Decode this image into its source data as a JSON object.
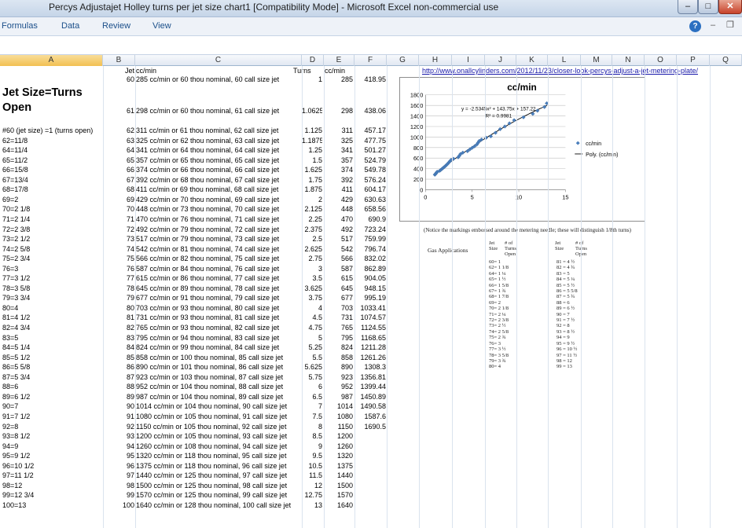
{
  "window": {
    "title": "Percys Adjustajet Holley turns per jet size chart1  [Compatibility Mode] - Microsoft Excel non-commercial use"
  },
  "ribbon": {
    "tabs": [
      "Formulas",
      "Data",
      "Review",
      "View"
    ]
  },
  "columns": [
    "A",
    "B",
    "C",
    "D",
    "E",
    "F",
    "G",
    "H",
    "I",
    "J",
    "K",
    "L",
    "M",
    "N",
    "O",
    "P",
    "Q"
  ],
  "header_row": {
    "b": "Jet",
    "c": "cc/min",
    "d": "Turns",
    "e": "cc/min"
  },
  "big_label": {
    "line1": "Jet Size=Turns",
    "line2": "Open"
  },
  "link": "http://www.onallcylinders.com/2012/11/23/closer-look-percys-adjust-a-jet-metering-plate/",
  "rows": [
    [
      "",
      "60",
      "285 cc/min or 60 thou nominal, 60 call size jet",
      "1",
      "285",
      "418.95"
    ],
    [
      "",
      "61",
      "298 cc/min or 60 thou nominal, 61 call size jet",
      "1.0625",
      "298",
      "438.06"
    ],
    [
      "#60 (jet size) =1 (turns open)",
      "62",
      "311 cc/min or 61 thou nominal, 62 call size jet",
      "1.125",
      "311",
      "457.17"
    ],
    [
      "62=11/8",
      "63",
      "325 cc/min or 62 thou nominal, 63 call size jet",
      "1.1875",
      "325",
      "477.75"
    ],
    [
      "64=11/4",
      "64",
      "341 cc/min or 64 thou nominal, 64 call size jet",
      "1.25",
      "341",
      "501.27"
    ],
    [
      "65=11/2",
      "65",
      "357 cc/min or 65 thou nominal, 65 call size jet",
      "1.5",
      "357",
      "524.79"
    ],
    [
      "66=15/8",
      "66",
      "374 cc/min or 66 thou nominal, 66 call size jet",
      "1.625",
      "374",
      "549.78"
    ],
    [
      "67=13/4",
      "67",
      "392 cc/min or 68 thou nominal, 67 call size jet",
      "1.75",
      "392",
      "576.24"
    ],
    [
      "68=17/8",
      "68",
      "411 cc/min or 69 thou nominal, 68 call size jet",
      "1.875",
      "411",
      "604.17"
    ],
    [
      "69=2",
      "69",
      "429 cc/min or 70 thou nominal, 69 call size jet",
      "2",
      "429",
      "630.63"
    ],
    [
      "70=2 1/8",
      "70",
      "448 cc/min or 73 thou nominal, 70 call size jet",
      "2.125",
      "448",
      "658.56"
    ],
    [
      "71=2 1/4",
      "71",
      "470 cc/min or 76 thou nominal, 71 call size jet",
      "2.25",
      "470",
      "690.9"
    ],
    [
      "72=2 3/8",
      "72",
      "492 cc/min or 79 thou nominal, 72 call size jet",
      "2.375",
      "492",
      "723.24"
    ],
    [
      "73=2 1/2",
      "73",
      "517 cc/min or 79 thou nominal, 73 call size jet",
      "2.5",
      "517",
      "759.99"
    ],
    [
      "74=2 5/8",
      "74",
      "542 cc/min or 81 thou nominal, 74 call size jet",
      "2.625",
      "542",
      "796.74"
    ],
    [
      "75=2 3/4",
      "75",
      "566 cc/min or 82 thou nominal, 75 call size jet",
      "2.75",
      "566",
      "832.02"
    ],
    [
      "76=3",
      "76",
      "587 cc/min or 84 thou nominal, 76 call size jet",
      "3",
      "587",
      "862.89"
    ],
    [
      "77=3 1/2",
      "77",
      "615 cc/min or 86 thou nominal, 77 call size jet",
      "3.5",
      "615",
      "904.05"
    ],
    [
      "78=3 5/8",
      "78",
      "645 cc/min or 89 thou nominal, 78 call size jet",
      "3.625",
      "645",
      "948.15"
    ],
    [
      "79=3 3/4",
      "79",
      "677 cc/min or 91 thou nominal, 79 call size jet",
      "3.75",
      "677",
      "995.19"
    ],
    [
      "80=4",
      "80",
      "703 cc/min or 93 thou nominal, 80 call size jet",
      "4",
      "703",
      "1033.41"
    ],
    [
      "81=4 1/2",
      "81",
      "731 cc/min or 93 thou nominal, 81 call size jet",
      "4.5",
      "731",
      "1074.57"
    ],
    [
      "82=4 3/4",
      "82",
      "765 cc/min or 93 thou nominal, 82 call size jet",
      "4.75",
      "765",
      "1124.55"
    ],
    [
      "83=5",
      "83",
      "795 cc/min or 94 thou nominal, 83 call size jet",
      "5",
      "795",
      "1168.65"
    ],
    [
      "84=5 1/4",
      "84",
      "824 cc/min or 99 thou nominal, 84 call size jet",
      "5.25",
      "824",
      "1211.28"
    ],
    [
      "85=5 1/2",
      "85",
      "858 cc/min or 100 thou nominal, 85 call size jet",
      "5.5",
      "858",
      "1261.26"
    ],
    [
      "86=5 5/8",
      "86",
      "890 cc/min or 101 thou nominal, 86 call size jet",
      "5.625",
      "890",
      "1308.3"
    ],
    [
      "87=5 3/4",
      "87",
      "923 cc/min or 103 thou nominal, 87 call size jet",
      "5.75",
      "923",
      "1356.81"
    ],
    [
      "88=6",
      "88",
      "952 cc/min or 104 thou nominal, 88 call size jet",
      "6",
      "952",
      "1399.44"
    ],
    [
      "89=6 1/2",
      "89",
      "987 cc/min or 104 thou nominal, 89 call size jet",
      "6.5",
      "987",
      "1450.89"
    ],
    [
      "90=7",
      "90",
      "1014 cc/min or 104 thou nominal, 90 call size jet",
      "7",
      "1014",
      "1490.58"
    ],
    [
      "91=7 1/2",
      "91",
      "1080 cc/min or 105 thou nominal, 91 call size jet",
      "7.5",
      "1080",
      "1587.6"
    ],
    [
      "92=8",
      "92",
      "1150 cc/min or 105 thou nominal, 92 call size jet",
      "8",
      "1150",
      "1690.5"
    ],
    [
      "93=8 1/2",
      "93",
      "1200 cc/min or 105 thou nominal, 93 call size jet",
      "8.5",
      "1200",
      ""
    ],
    [
      "94=9",
      "94",
      "1260 cc/min or 108 thou nominal, 94 call size jet",
      "9",
      "1260",
      ""
    ],
    [
      "95=9 1/2",
      "95",
      "1320 cc/min or 118 thou nominal, 95 call size jet",
      "9.5",
      "1320",
      ""
    ],
    [
      "96=10 1/2",
      "96",
      "1375 cc/min or 118 thou nominal, 96 call size jet",
      "10.5",
      "1375",
      ""
    ],
    [
      "97=11 1/2",
      "97",
      "1440 cc/min or 125 thou nominal, 97 call size jet",
      "11.5",
      "1440",
      ""
    ],
    [
      "98=12",
      "98",
      "1500 cc/min or 125 thou nominal, 98 call size jet",
      "12",
      "1500",
      ""
    ],
    [
      "99=12 3/4",
      "99",
      "1570 cc/min or 125 thou nominal, 99 call size jet",
      "12.75",
      "1570",
      ""
    ],
    [
      "100=13",
      "100",
      "1640 cc/min or 128 thou nominal, 100 call size jet",
      "13",
      "1640",
      ""
    ]
  ],
  "chart_data": {
    "type": "scatter",
    "title": "cc/min",
    "xlabel": "",
    "ylabel": "",
    "xlim": [
      0,
      15
    ],
    "ylim": [
      0,
      1800
    ],
    "xticks": [
      0,
      5,
      10,
      15
    ],
    "yticks": [
      0,
      200,
      400,
      600,
      800,
      1000,
      1200,
      1400,
      1600,
      1800
    ],
    "grid": "horizontal",
    "legend": "right",
    "equation": "y = -2.5345x² + 143.75x + 157.22",
    "r_squared": "R² = 0.9981",
    "trend_coeffs": [
      157.22,
      143.75,
      -2.5345
    ],
    "colors": {
      "series": "#4a7ebb",
      "trend": "#000000"
    },
    "series": [
      {
        "name": "cc/min",
        "x": [
          1,
          1.0625,
          1.125,
          1.1875,
          1.25,
          1.5,
          1.625,
          1.75,
          1.875,
          2,
          2.125,
          2.25,
          2.375,
          2.5,
          2.625,
          2.75,
          3,
          3.5,
          3.625,
          3.75,
          4,
          4.5,
          4.75,
          5,
          5.25,
          5.5,
          5.625,
          5.75,
          6,
          6.5,
          7,
          7.5,
          8,
          8.5,
          9,
          9.5,
          10.5,
          11.5,
          12,
          12.75,
          13
        ],
        "y": [
          285,
          298,
          311,
          325,
          341,
          357,
          374,
          392,
          411,
          429,
          448,
          470,
          492,
          517,
          542,
          566,
          587,
          615,
          645,
          677,
          703,
          731,
          765,
          795,
          824,
          858,
          890,
          923,
          952,
          987,
          1014,
          1080,
          1150,
          1200,
          1260,
          1320,
          1375,
          1440,
          1500,
          1570,
          1640
        ]
      },
      {
        "name": "Poly. (cc/min)"
      }
    ]
  },
  "scan": {
    "note": "(Notice the markings embossed around the metering needle; these will distinguish 1/8th turns)",
    "gas_label": "Gas Applications",
    "col1_header": [
      "Jet",
      "Size"
    ],
    "col2_header": [
      "# of",
      "Turns",
      "Open"
    ],
    "left": [
      "60=  1",
      "62=  1 1/8",
      "64=  1 ¼",
      "65=  1 ½",
      "66=  1 5/8",
      "67=  1 ¾",
      "68=  1 7/8",
      "69=  2",
      "70=  2 1/8",
      "71=  2 ¼",
      "72=  2 3/8",
      "73=  2 ½",
      "74=  2 5/8",
      "75=  2 ¾",
      "76=  3",
      "77=  3 ½",
      "78=  3 5/8",
      "79=  3 ¾",
      "80=  4"
    ],
    "right": [
      "81  =  4 ½",
      "82  =  4 ¾",
      "83  =  5",
      "84  =  5 ¼",
      "85  =  5 ½",
      "86  =  5 5/8",
      "87  =  5 ¾",
      "88  =  6",
      "89  =  6 ½",
      "90  =  7",
      "91  =  7 ½",
      "92  =  8",
      "93  =  8 ½",
      "94  =  9",
      "95  =  9 ½",
      "96  =  10 ½",
      "97  =  11 ½",
      "98  =  12",
      "99  =  13"
    ]
  }
}
